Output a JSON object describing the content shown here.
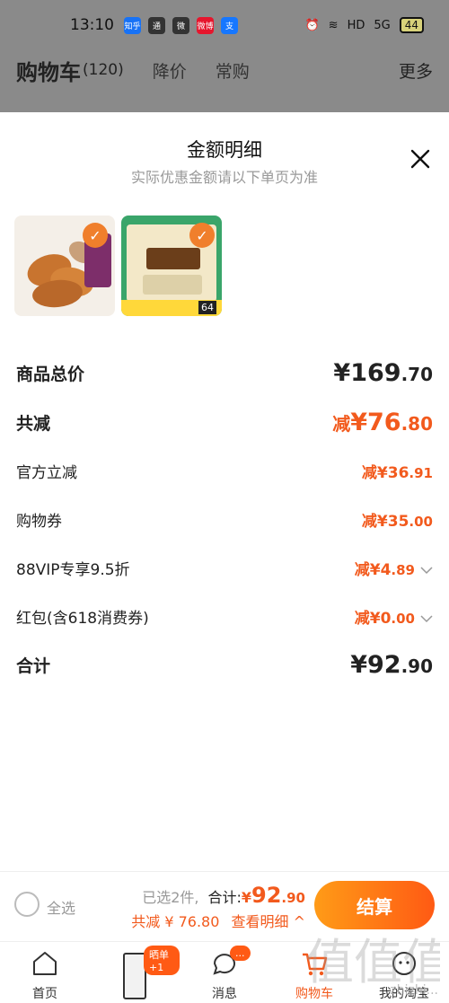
{
  "status_bar": {
    "time": "13:10",
    "apps": [
      "知乎",
      "通",
      "微",
      "微博",
      "支"
    ],
    "right": [
      "HD",
      "5G",
      "44"
    ]
  },
  "background_nav": {
    "title": "购物车",
    "count": "(120)",
    "tabs": [
      "降价",
      "常购"
    ],
    "more": "更多"
  },
  "sheet": {
    "title": "金额明细",
    "subtitle": "实际优惠金额请以下单页为准",
    "thumb2_price": "64"
  },
  "breakdown": {
    "goods_total_label": "商品总价",
    "goods_total_int": "¥169",
    "goods_total_dec": ".70",
    "total_reduce_label": "共减",
    "total_reduce_prefix": "减",
    "total_reduce_int": "¥76",
    "total_reduce_dec": ".80",
    "official_label": "官方立减",
    "official_prefix": "减",
    "official_int": "¥36",
    "official_dec": ".91",
    "coupon_label": "购物券",
    "coupon_prefix": "减",
    "coupon_int": "¥35",
    "coupon_dec": ".00",
    "vip_label": "88VIP专享9.5折",
    "vip_prefix": "减",
    "vip_int": "¥4",
    "vip_dec": ".89",
    "redpack_label": "红包(含618消费券)",
    "redpack_prefix": "减",
    "redpack_int": "¥0",
    "redpack_dec": ".00",
    "sum_label": "合计",
    "sum_int": "¥92",
    "sum_dec": ".90"
  },
  "checkout": {
    "select_all": "全选",
    "selected": "已选2件,",
    "total_label": "合计:",
    "yen": "¥",
    "price_int": "92",
    "price_dec": ".90",
    "reduce_text": "共减 ¥ 76.80",
    "detail_link": "查看明细 ^",
    "button": "结算"
  },
  "tabbar": {
    "items": [
      "首页",
      "晒单+1",
      "消息",
      "购物车",
      "我的淘宝"
    ],
    "home_label": "首页",
    "promo_badge": "晒单+1",
    "messages_label": "消息",
    "messages_badge": "...",
    "cart_label": "购物车",
    "mine_label": "我的淘宝"
  },
  "watermark": "值",
  "watermark_url": "zhizhi...",
  "colors": {
    "accent": "#f25a1d",
    "check": "#f07f2c",
    "button_from": "#ff9b17",
    "button_to": "#ff5a14"
  }
}
